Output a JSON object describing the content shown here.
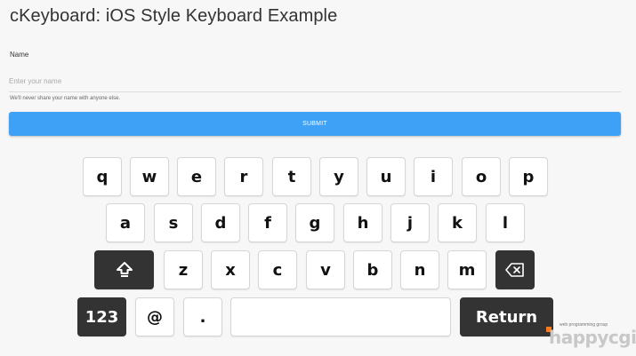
{
  "header": {
    "title": "cKeyboard: iOS Style Keyboard Example"
  },
  "form": {
    "name_label": "Name",
    "name_placeholder": "Enter your name",
    "name_value": "",
    "help_text": "We'll never share your name with anyone else.",
    "submit_label": "SUBMIT"
  },
  "keyboard": {
    "row1": [
      "q",
      "w",
      "e",
      "r",
      "t",
      "y",
      "u",
      "i",
      "o",
      "p"
    ],
    "row2": [
      "a",
      "s",
      "d",
      "f",
      "g",
      "h",
      "j",
      "k",
      "l"
    ],
    "row3": [
      "z",
      "x",
      "c",
      "v",
      "b",
      "n",
      "m"
    ],
    "numbers_label": "123",
    "at_label": "@",
    "dot_label": ".",
    "return_label": "Return",
    "shift_icon": "shift-icon",
    "backspace_icon": "backspace-icon"
  },
  "watermark": {
    "tagline": "web programming group",
    "brand": "happycgi"
  },
  "colors": {
    "accent": "#3ea1f6",
    "dark_key": "#333333",
    "brand_orange": "#ff7a1a"
  }
}
